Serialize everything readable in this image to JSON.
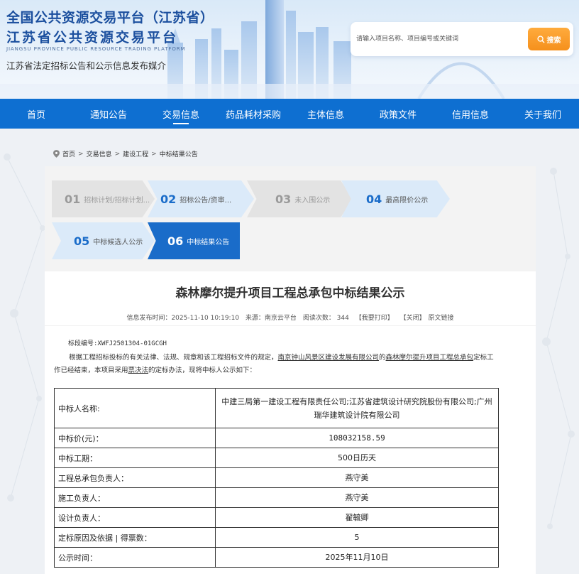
{
  "header": {
    "title_line1": "全国公共资源交易平台（江苏省）",
    "title_line2": "江苏省公共资源交易平台",
    "title_en": "JIANGSU PROVINCE PUBLIC RESOURCE TRADING PLATFORM",
    "slogan": "江苏省法定招标公告和公示信息发布媒介",
    "search_placeholder": "请输入项目名称、项目编号或关键词",
    "search_label": "搜索"
  },
  "nav": {
    "items": [
      "首页",
      "通知公告",
      "交易信息",
      "药品耗材采购",
      "主体信息",
      "政策文件",
      "信用信息",
      "关于我们"
    ]
  },
  "breadcrumb": [
    "首页",
    "交易信息",
    "建设工程",
    "中标结果公告"
  ],
  "steps": [
    {
      "num": "01",
      "label": "招标计划/招标计划..."
    },
    {
      "num": "02",
      "label": "招标公告/资审..."
    },
    {
      "num": "03",
      "label": "未入围公示"
    },
    {
      "num": "04",
      "label": "最高限价公示"
    },
    {
      "num": "05",
      "label": "中标候选人公示"
    },
    {
      "num": "06",
      "label": "中标结果公告"
    }
  ],
  "article": {
    "title": "森林摩尔提升项目工程总承包中标结果公示",
    "meta_time": "信息发布时间：2025-11-10 10:19:10",
    "meta_source": "来源：南京云平台",
    "meta_views": "阅读次数：  344",
    "print_label": "【我要打印】",
    "close_label": "【关闭】",
    "original_label": "原文链接",
    "section_no": "标段编号:XWFJ2501304-01GCGH",
    "para_a": "根据工程招标投标的有关法律、法规、规章和该工程招标文件的规定，",
    "para_link1": "南京钟山风景区建设发展有限公司",
    "para_b": "的",
    "para_link2": "森林摩尔提升项目工程总承包",
    "para_c": "定标工作已经结束，本项目采用",
    "para_link3": "票决法",
    "para_d": "的定标办法，现将中标人公示如下："
  },
  "table": [
    {
      "key": "中标人名称:",
      "value": "中建三局第一建设工程有限责任公司;江苏省建筑设计研究院股份有限公司;广州瑞华建筑设计院有限公司"
    },
    {
      "key": "中标价(元)：",
      "value": "108032158.59"
    },
    {
      "key": "中标工期：",
      "value": "500日历天"
    },
    {
      "key": "工程总承包负责人：",
      "value": "燕守美"
    },
    {
      "key": "施工负责人：",
      "value": "燕守美"
    },
    {
      "key": "设计负责人：",
      "value": "翟毓卿"
    },
    {
      "key": "定标原因及依据 | 得票数：",
      "value": "5"
    },
    {
      "key": "公示时间：",
      "value": "2025年11月10日"
    }
  ],
  "colors": {
    "nav_bg": "#0e6fd1",
    "title_blue": "#1b4f9e",
    "search_orange": "#f5901c",
    "step_active": "#1a6cc9",
    "step_light": "#dbeaf9",
    "step_gray": "#e3e3e3"
  },
  "icons": [
    "search-icon",
    "location-pin-icon"
  ]
}
